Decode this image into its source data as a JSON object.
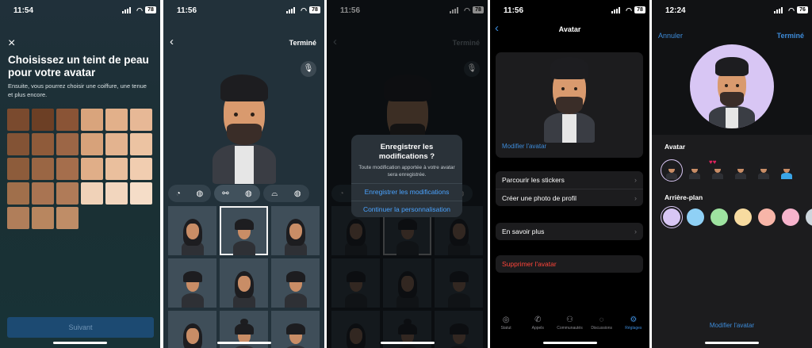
{
  "colors": {
    "accent": "#3d8bd9",
    "destructive": "#ff453a",
    "primary_button": "#1c4a72"
  },
  "screens": {
    "s1": {
      "status_time": "11:54",
      "battery": "78",
      "close_icon": "×",
      "title": "Choisissez un teint de peau pour votre avatar",
      "subtitle": "Ensuite, vous pourrez choisir une coiffure, une tenue et plus encore.",
      "swatches": [
        "#7a4a2e",
        "#6c3f25",
        "#8a5436",
        "#d9a47c",
        "#e2b08a",
        "#e7b896",
        "#835335",
        "#8f5b3a",
        "#9c6646",
        "#d7a27a",
        "#e3b38f",
        "#ecc3a2",
        "#8d5c3b",
        "#9a6644",
        "#a56e4c",
        "#e0ae88",
        "#eabf9d",
        "#f1cdb0",
        "#a06f4b",
        "#a97452",
        "#b07b58",
        "#f0d2b8",
        "#f2d6be",
        "#f5ddc8",
        "#b07e5a",
        "#b8865f",
        "#bf8d67"
      ],
      "cta": "Suivant"
    },
    "s2": {
      "status_time": "11:56",
      "battery": "78",
      "back_icon": "‹",
      "done": "Terminé",
      "tabs": [
        {
          "icons": [
            "ear-icon",
            "palette-icon"
          ]
        },
        {
          "icons": [
            "glasses-icon",
            "palette-icon"
          ]
        },
        {
          "icons": [
            "hat-icon",
            "palette-icon"
          ]
        }
      ],
      "grid": [
        {
          "hair": "long"
        },
        {
          "hair": "short",
          "selected": true
        },
        {
          "hair": "long"
        },
        {
          "hair": "short"
        },
        {
          "hair": "long"
        },
        {
          "hair": "short"
        },
        {
          "hair": "long"
        },
        {
          "hair": "bun"
        },
        {
          "hair": "short"
        }
      ]
    },
    "s3": {
      "status_time": "11:56",
      "battery": "78",
      "done": "Terminé",
      "dialog_title": "Enregistrer les modifications ?",
      "dialog_message": "Toute modification apportée à votre avatar sera enregistrée.",
      "dialog_primary": "Enregistrer les modifications",
      "dialog_secondary": "Continuer la personnalisation"
    },
    "s4": {
      "status_time": "11:56",
      "battery": "78",
      "title": "Avatar",
      "edit_link": "Modifier l'avatar",
      "rows_group1": [
        "Parcourir les stickers",
        "Créer une photo de profil"
      ],
      "rows_group2": [
        "En savoir plus"
      ],
      "delete": "Supprimer l'avatar",
      "tabbar": [
        {
          "label": "Statut",
          "icon": "status-icon"
        },
        {
          "label": "Appels",
          "icon": "phone-icon"
        },
        {
          "label": "Communautés",
          "icon": "communities-icon"
        },
        {
          "label": "Discussions",
          "icon": "chats-icon"
        },
        {
          "label": "Réglages",
          "icon": "settings-icon",
          "active": true
        }
      ]
    },
    "s5": {
      "status_time": "12:24",
      "battery": "76",
      "cancel": "Annuler",
      "done": "Terminé",
      "avatar_label": "Avatar",
      "background_label": "Arrière-plan",
      "bg_colors": [
        "#d8c6f4",
        "#8fd0f5",
        "#9ee3a0",
        "#f7dba0",
        "#f7b5a8",
        "#f7b3cc",
        "#cdd6dd",
        "#c7e8f7"
      ],
      "edit_link": "Modifier l'avatar"
    }
  }
}
